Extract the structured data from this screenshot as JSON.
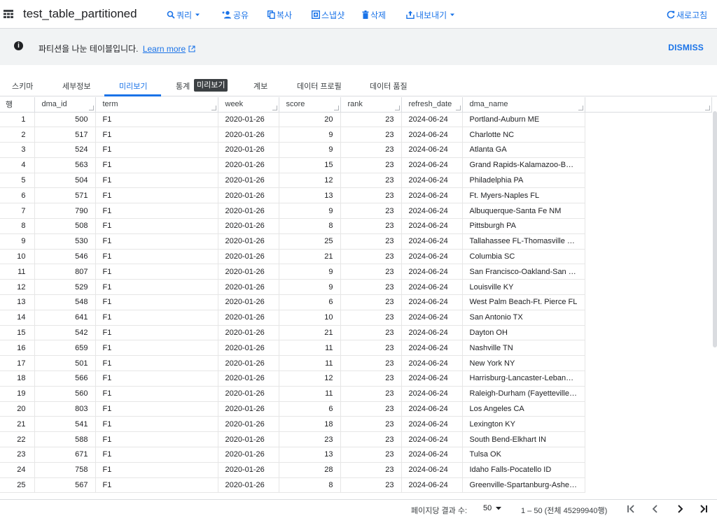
{
  "header": {
    "title": "test_table_partitioned",
    "buttons": {
      "query": "쿼리",
      "share": "공유",
      "copy": "복사",
      "snapshot": "스냅샷",
      "delete": "삭제",
      "export": "내보내기",
      "refresh": "새로고침"
    }
  },
  "banner": {
    "text": "파티션을 나눈 테이블입니다.",
    "link": "Learn more",
    "dismiss": "DISMISS"
  },
  "tabs": {
    "schema": "스키마",
    "details": "세부정보",
    "preview": "미리보기",
    "stats": "통계",
    "lineage": "계보",
    "profile": "데이터 프로필",
    "quality": "데이터 품질",
    "tooltip": "미리보기"
  },
  "table": {
    "columns": [
      "행",
      "dma_id",
      "term",
      "week",
      "score",
      "rank",
      "refresh_date",
      "dma_name"
    ],
    "rows": [
      [
        "1",
        "500",
        "F1",
        "2020-01-26",
        "20",
        "23",
        "2024-06-24",
        "Portland-Auburn ME"
      ],
      [
        "2",
        "517",
        "F1",
        "2020-01-26",
        "9",
        "23",
        "2024-06-24",
        "Charlotte NC"
      ],
      [
        "3",
        "524",
        "F1",
        "2020-01-26",
        "9",
        "23",
        "2024-06-24",
        "Atlanta GA"
      ],
      [
        "4",
        "563",
        "F1",
        "2020-01-26",
        "15",
        "23",
        "2024-06-24",
        "Grand Rapids-Kalamazoo-Battl..."
      ],
      [
        "5",
        "504",
        "F1",
        "2020-01-26",
        "12",
        "23",
        "2024-06-24",
        "Philadelphia PA"
      ],
      [
        "6",
        "571",
        "F1",
        "2020-01-26",
        "13",
        "23",
        "2024-06-24",
        "Ft. Myers-Naples FL"
      ],
      [
        "7",
        "790",
        "F1",
        "2020-01-26",
        "9",
        "23",
        "2024-06-24",
        "Albuquerque-Santa Fe NM"
      ],
      [
        "8",
        "508",
        "F1",
        "2020-01-26",
        "8",
        "23",
        "2024-06-24",
        "Pittsburgh PA"
      ],
      [
        "9",
        "530",
        "F1",
        "2020-01-26",
        "25",
        "23",
        "2024-06-24",
        "Tallahassee FL-Thomasville GA"
      ],
      [
        "10",
        "546",
        "F1",
        "2020-01-26",
        "21",
        "23",
        "2024-06-24",
        "Columbia SC"
      ],
      [
        "11",
        "807",
        "F1",
        "2020-01-26",
        "9",
        "23",
        "2024-06-24",
        "San Francisco-Oakland-San Jo..."
      ],
      [
        "12",
        "529",
        "F1",
        "2020-01-26",
        "9",
        "23",
        "2024-06-24",
        "Louisville KY"
      ],
      [
        "13",
        "548",
        "F1",
        "2020-01-26",
        "6",
        "23",
        "2024-06-24",
        "West Palm Beach-Ft. Pierce FL"
      ],
      [
        "14",
        "641",
        "F1",
        "2020-01-26",
        "10",
        "23",
        "2024-06-24",
        "San Antonio TX"
      ],
      [
        "15",
        "542",
        "F1",
        "2020-01-26",
        "21",
        "23",
        "2024-06-24",
        "Dayton OH"
      ],
      [
        "16",
        "659",
        "F1",
        "2020-01-26",
        "11",
        "23",
        "2024-06-24",
        "Nashville TN"
      ],
      [
        "17",
        "501",
        "F1",
        "2020-01-26",
        "11",
        "23",
        "2024-06-24",
        "New York NY"
      ],
      [
        "18",
        "566",
        "F1",
        "2020-01-26",
        "12",
        "23",
        "2024-06-24",
        "Harrisburg-Lancaster-Lebanon-..."
      ],
      [
        "19",
        "560",
        "F1",
        "2020-01-26",
        "11",
        "23",
        "2024-06-24",
        "Raleigh-Durham (Fayetteville) ..."
      ],
      [
        "20",
        "803",
        "F1",
        "2020-01-26",
        "6",
        "23",
        "2024-06-24",
        "Los Angeles CA"
      ],
      [
        "21",
        "541",
        "F1",
        "2020-01-26",
        "18",
        "23",
        "2024-06-24",
        "Lexington KY"
      ],
      [
        "22",
        "588",
        "F1",
        "2020-01-26",
        "23",
        "23",
        "2024-06-24",
        "South Bend-Elkhart IN"
      ],
      [
        "23",
        "671",
        "F1",
        "2020-01-26",
        "13",
        "23",
        "2024-06-24",
        "Tulsa OK"
      ],
      [
        "24",
        "758",
        "F1",
        "2020-01-26",
        "28",
        "23",
        "2024-06-24",
        "Idaho Falls-Pocatello ID"
      ],
      [
        "25",
        "567",
        "F1",
        "2020-01-26",
        "8",
        "23",
        "2024-06-24",
        "Greenville-Spartanburg-Ashevill..."
      ]
    ]
  },
  "footer": {
    "page_size_label": "페이지당 결과 수:",
    "page_size": "50",
    "range": "1 – 50 (전체 45299940행)"
  },
  "colors": {
    "accent": "#1a73e8",
    "banner_bg": "#f1f3f4"
  }
}
